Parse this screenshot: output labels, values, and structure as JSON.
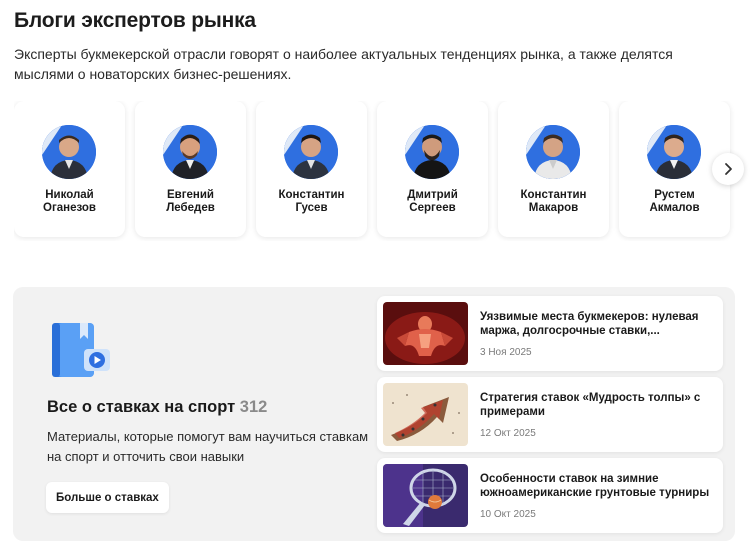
{
  "header": {
    "title": "Блоги экспертов рынка",
    "intro": "Эксперты букмекерской отрасли говорят о наиболее актуальных тенденциях рынка, а также делятся мыслями о новаторских бизнес-решениях."
  },
  "experts": [
    {
      "first": "Николай",
      "last": "Оганезов"
    },
    {
      "first": "Евгений",
      "last": "Лебедев"
    },
    {
      "first": "Константин",
      "last": "Гусев"
    },
    {
      "first": "Дмитрий",
      "last": "Сергеев"
    },
    {
      "first": "Константин",
      "last": "Макаров"
    },
    {
      "first": "Рустем",
      "last": "Акмалов"
    }
  ],
  "guide": {
    "title": "Все о ставках на спорт",
    "count": "312",
    "description": "Материалы, которые помогут вам научиться ставкам на спорт и отточить свои навыки",
    "button_label": "Больше о ставках"
  },
  "articles": [
    {
      "title": "Уязвимые места букмекеров: нулевая маржа, долгосрочные ставки,...",
      "date": "3 Ноя 2025",
      "thumb": "muscle-figure-image"
    },
    {
      "title": "Стратегия ставок «Мудрость толпы» с примерами",
      "date": "12 Окт 2025",
      "thumb": "crowd-arrow-image"
    },
    {
      "title": "Особенности ставок на зимние южноамериканские грунтовые турниры",
      "date": "10 Окт 2025",
      "thumb": "tennis-racket-image"
    }
  ],
  "colors": {
    "accent_blue": "#2f6fe0",
    "panel_bg": "#f2f2f2",
    "count_gray": "#8a8a8a"
  }
}
